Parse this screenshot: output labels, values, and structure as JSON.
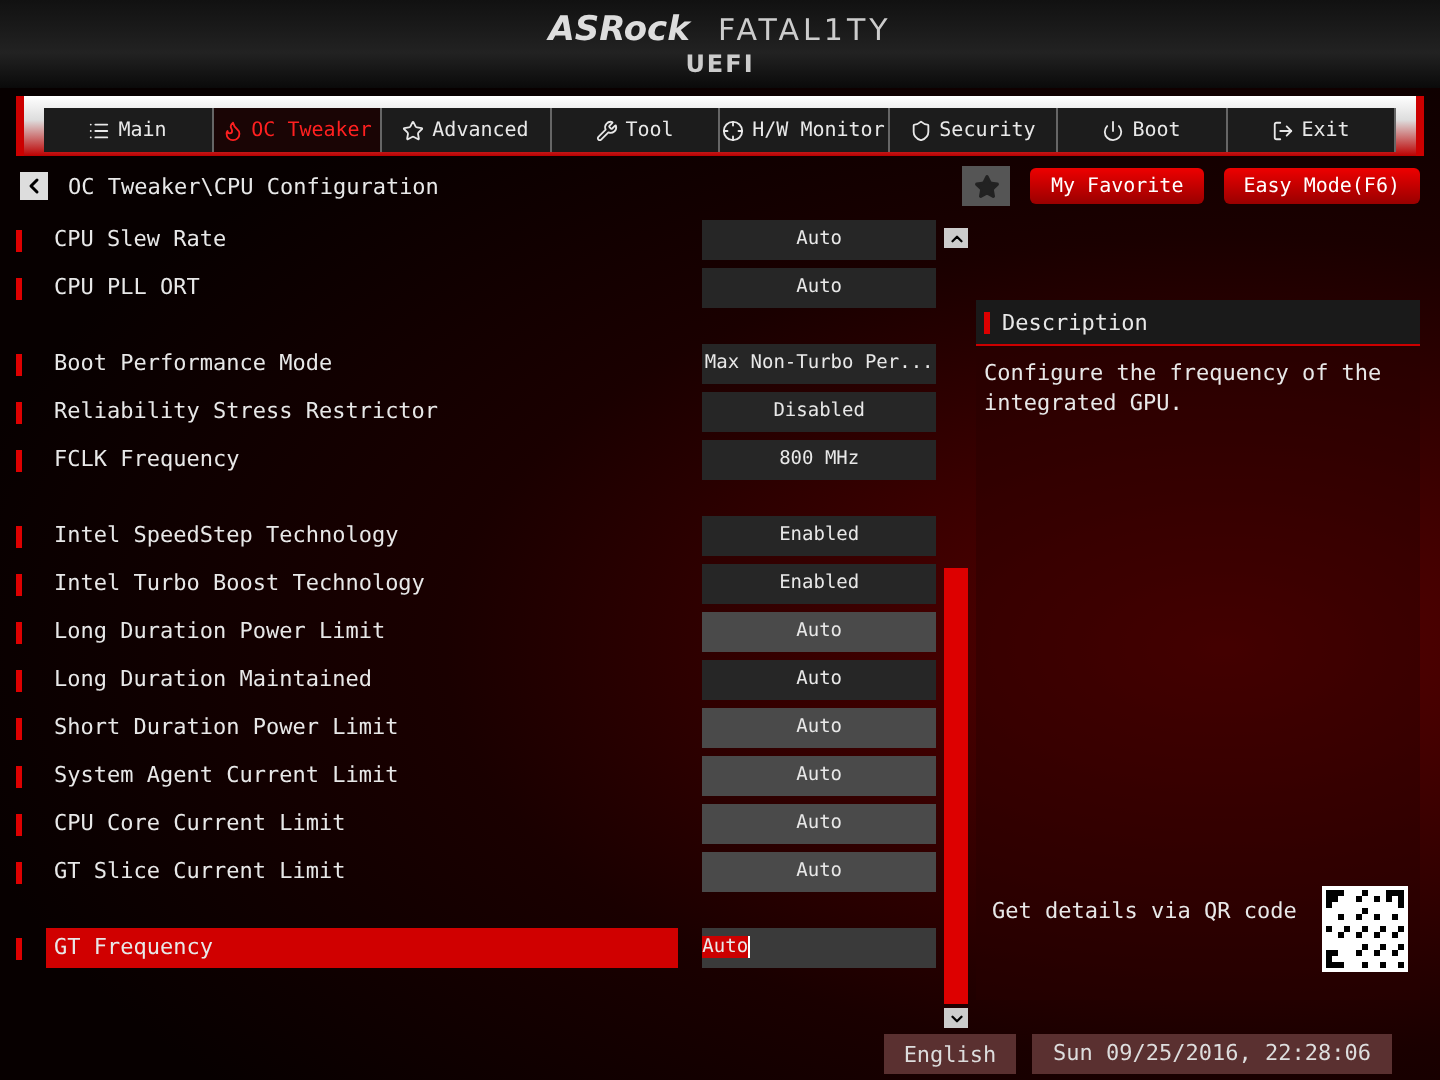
{
  "logo": {
    "brand": "ASRock",
    "series": "FATAL1TY",
    "subtitle": "UEFI"
  },
  "tabs": [
    {
      "label": "Main",
      "selected": false
    },
    {
      "label": "OC Tweaker",
      "selected": true
    },
    {
      "label": "Advanced",
      "selected": false
    },
    {
      "label": "Tool",
      "selected": false
    },
    {
      "label": "H/W Monitor",
      "selected": false
    },
    {
      "label": "Security",
      "selected": false
    },
    {
      "label": "Boot",
      "selected": false
    },
    {
      "label": "Exit",
      "selected": false
    }
  ],
  "breadcrumb": "OC Tweaker\\CPU Configuration",
  "favorite": {
    "label": "My Favorite"
  },
  "easy_mode": {
    "label": "Easy Mode(F6)"
  },
  "groups": [
    {
      "rows": [
        {
          "label": "CPU Slew Rate",
          "value": "Auto",
          "kind": "select",
          "selected": false
        },
        {
          "label": "CPU PLL ORT",
          "value": "Auto",
          "kind": "select",
          "selected": false
        }
      ]
    },
    {
      "rows": [
        {
          "label": "Boot Performance Mode",
          "value": "Max Non-Turbo Per...",
          "kind": "select",
          "selected": false
        },
        {
          "label": "Reliability Stress Restrictor",
          "value": "Disabled",
          "kind": "select",
          "selected": false
        },
        {
          "label": "FCLK Frequency",
          "value": "800 MHz",
          "kind": "select",
          "selected": false
        }
      ]
    },
    {
      "rows": [
        {
          "label": "Intel SpeedStep Technology",
          "value": "Enabled",
          "kind": "select",
          "selected": false
        },
        {
          "label": "Intel Turbo Boost Technology",
          "value": "Enabled",
          "kind": "select",
          "selected": false
        },
        {
          "label": "Long Duration Power Limit",
          "value": "Auto",
          "kind": "input",
          "selected": false
        },
        {
          "label": "Long Duration Maintained",
          "value": "Auto",
          "kind": "select",
          "selected": false
        },
        {
          "label": "Short Duration Power Limit",
          "value": "Auto",
          "kind": "input",
          "selected": false
        },
        {
          "label": "System Agent Current Limit",
          "value": "Auto",
          "kind": "input",
          "selected": false
        },
        {
          "label": "CPU Core Current Limit",
          "value": "Auto",
          "kind": "input",
          "selected": false
        },
        {
          "label": "GT Slice Current Limit",
          "value": "Auto",
          "kind": "input",
          "selected": false
        }
      ]
    },
    {
      "rows": [
        {
          "label": "GT Frequency",
          "value": "Auto",
          "kind": "input",
          "selected": true
        }
      ]
    }
  ],
  "description": {
    "title": "Description",
    "text": "Configure the frequency of the integrated GPU.",
    "qr_hint": "Get details via QR code"
  },
  "status_bar": {
    "language": "English",
    "datetime": "Sun 09/25/2016, 22:28:06"
  }
}
